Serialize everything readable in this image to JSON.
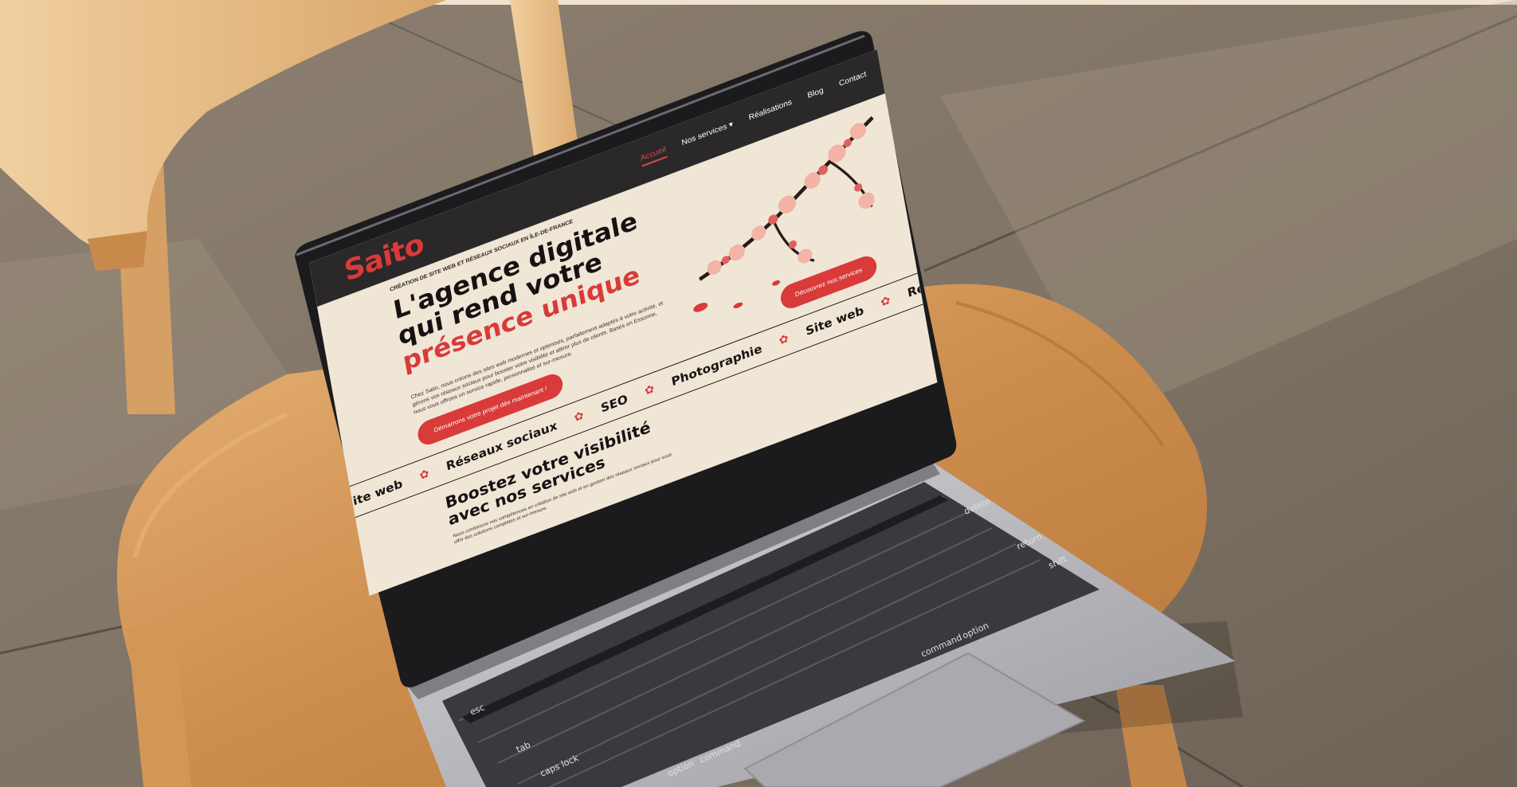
{
  "scene": {
    "description_free": true
  },
  "website": {
    "logo": "Saito",
    "nav": [
      {
        "label": "Accueil",
        "active": true
      },
      {
        "label": "Nos services ▾",
        "active": false
      },
      {
        "label": "Réalisations",
        "active": false
      },
      {
        "label": "Blog",
        "active": false
      },
      {
        "label": "Contact",
        "active": false
      }
    ],
    "eyebrow": "CRÉATION DE SITE WEB ET RÉSEAUX SOCIAUX EN ÎLE-DE-FRANCE",
    "headline_part1": "L'agence digitale qui rend votre ",
    "headline_red1": "présence",
    "headline_red2": "unique",
    "intro": "Chez Saito, nous créons des sites web modernes et optimisés, parfaitement adaptés à votre activité, et gérons vos réseaux sociaux pour booster votre visibilité et attirer plus de clients. Basés en Essonne, nous vous offrons un service rapide, personnalisé et sur-mesure.",
    "cta_primary": "Démarrons votre projet dès maintenant !",
    "cta_secondary": "Découvrez nos services",
    "marquee": [
      "Site web",
      "Réseaux sociaux",
      "SEO",
      "Photographie",
      "Site web",
      "Réseaux sociaux"
    ],
    "section_title": "Boostez votre visibilité avec nos services",
    "section_body": "Nous combinons nos compétences en création de site web et en gestion des réseaux sociaux pour vous offrir des solutions complètes et sur-mesure."
  },
  "keyboard": {
    "keys": [
      "esc",
      "tab",
      "caps lock",
      "option",
      "command",
      "return",
      "delete",
      "shift",
      "command",
      "option"
    ]
  },
  "colors": {
    "brand_red": "#d93a3a",
    "nav_dark": "#2a2828",
    "screen_bg": "#efe6d6",
    "laptop_silver": "#b8b8bc",
    "wood": "#d9a263",
    "floor": "#857868"
  }
}
